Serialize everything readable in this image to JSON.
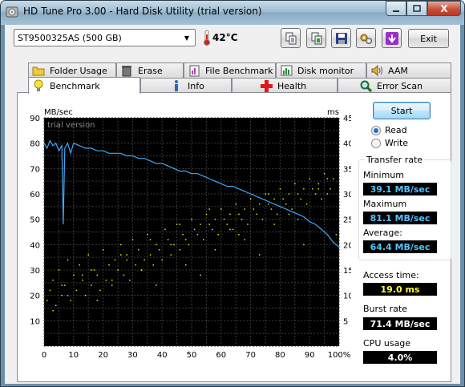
{
  "window": {
    "title": "HD Tune Pro 3.00 - Hard Disk Utility (trial version)",
    "close_glyph": "X"
  },
  "toolbar": {
    "drive": "ST9500325AS (500 GB)",
    "temperature": "42°C",
    "exit_label": "Exit",
    "buttons": [
      "copy-text-icon",
      "copy-screenshot-icon",
      "save-icon",
      "options-icon",
      "minimize-to-tray-icon"
    ]
  },
  "tabs": {
    "row1": [
      "Folder Usage",
      "Erase",
      "File Benchmark",
      "Disk monitor",
      "AAM"
    ],
    "row2": [
      "Benchmark",
      "Info",
      "Health",
      "Error Scan"
    ],
    "active": "Benchmark"
  },
  "benchmark": {
    "start_label": "Start",
    "read_label": "Read",
    "write_label": "Write",
    "mode": "Read",
    "transfer_rate_title": "Transfer rate",
    "minimum_label": "Minimum",
    "minimum_value": "39.1 MB/sec",
    "maximum_label": "Maximum",
    "maximum_value": "81.1 MB/sec",
    "average_label": "Average:",
    "average_value": "64.4 MB/sec",
    "access_time_label": "Access time:",
    "access_time_value": "19.0 ms",
    "burst_rate_label": "Burst rate",
    "burst_rate_value": "71.4 MB/sec",
    "cpu_usage_label": "CPU usage",
    "cpu_usage_value": "4.0%"
  },
  "colors": {
    "plot_bg": "#000000",
    "grid": "#3a3a3a",
    "transfer_line": "#3fa9f5",
    "access_points": "#e6e619",
    "panel_value_blue": "#4fc3ff",
    "panel_value_yellow": "#ffff3a"
  },
  "chart_data": {
    "type": "line",
    "watermark": "trial version",
    "y_left_unit": "MB/sec",
    "y_right_unit": "ms",
    "x_ticks": [
      "0",
      "10",
      "20",
      "30",
      "40",
      "50",
      "60",
      "70",
      "80",
      "90",
      "100%"
    ],
    "y_left_ticks": [
      "10",
      "20",
      "30",
      "40",
      "50",
      "60",
      "70",
      "80",
      "90"
    ],
    "y_right_ticks": [
      "5",
      "10",
      "15",
      "20",
      "25",
      "30",
      "35",
      "40",
      "45"
    ],
    "xlim": [
      0,
      100
    ],
    "ylim_left": [
      0,
      90
    ],
    "ylim_right": [
      0,
      45
    ],
    "grid": true,
    "series": [
      {
        "name": "Transfer rate",
        "axis": "left",
        "x": [
          0,
          1,
          2,
          3,
          4,
          5,
          6,
          6.5,
          7,
          8,
          9,
          10,
          12,
          14,
          16,
          18,
          20,
          22,
          24,
          26,
          28,
          30,
          32,
          34,
          36,
          38,
          40,
          42,
          44,
          46,
          48,
          50,
          52,
          54,
          56,
          58,
          60,
          62,
          64,
          66,
          68,
          70,
          72,
          74,
          76,
          78,
          80,
          82,
          84,
          86,
          88,
          90,
          92,
          94,
          96,
          98,
          100
        ],
        "values": [
          80,
          78,
          81,
          79,
          80,
          77,
          79,
          48,
          78,
          80,
          76,
          80,
          79,
          78,
          78,
          77,
          77,
          76,
          76,
          76,
          75,
          75,
          74,
          74,
          73,
          72,
          72,
          71,
          70,
          69,
          69,
          68,
          68,
          67,
          66,
          65,
          64,
          63,
          63,
          62,
          61,
          60,
          59,
          58,
          57,
          56,
          55,
          54,
          53,
          52,
          51,
          49,
          48,
          46,
          44,
          41,
          39
        ]
      }
    ],
    "scatter": {
      "name": "Access time",
      "axis": "right",
      "x": [
        1,
        2,
        3,
        4,
        5,
        6,
        7,
        8,
        9,
        10,
        11,
        12,
        13,
        14,
        15,
        16,
        17,
        18,
        19,
        20,
        21,
        22,
        23,
        24,
        25,
        26,
        27,
        28,
        29,
        30,
        31,
        32,
        33,
        34,
        35,
        36,
        37,
        38,
        39,
        40,
        41,
        42,
        43,
        44,
        45,
        46,
        47,
        48,
        49,
        50,
        51,
        52,
        53,
        54,
        55,
        56,
        57,
        58,
        59,
        60,
        61,
        62,
        63,
        64,
        65,
        66,
        67,
        68,
        69,
        70,
        71,
        72,
        73,
        74,
        75,
        76,
        77,
        78,
        79,
        80,
        81,
        82,
        83,
        84,
        85,
        86,
        87,
        88,
        89,
        90,
        91,
        92,
        93,
        94,
        95,
        96,
        97,
        98,
        99,
        3,
        8,
        13,
        18,
        23,
        28,
        33,
        38,
        43,
        48,
        53,
        58,
        63,
        68,
        73,
        78,
        83,
        88,
        93,
        6,
        16,
        26,
        36,
        46,
        56,
        66,
        76,
        86,
        96
      ],
      "values": [
        9,
        11,
        13,
        8,
        15,
        10,
        12,
        17,
        9,
        14,
        11,
        16,
        13,
        10,
        18,
        12,
        15,
        14,
        11,
        19,
        13,
        16,
        12,
        17,
        15,
        20,
        14,
        18,
        13,
        21,
        16,
        19,
        15,
        17,
        22,
        18,
        16,
        20,
        19,
        17,
        23,
        21,
        18,
        20,
        24,
        19,
        22,
        21,
        20,
        25,
        23,
        22,
        24,
        21,
        26,
        24,
        23,
        25,
        22,
        27,
        25,
        24,
        26,
        23,
        28,
        26,
        25,
        27,
        24,
        29,
        27,
        26,
        28,
        25,
        30,
        28,
        27,
        29,
        26,
        31,
        29,
        28,
        30,
        27,
        32,
        30,
        29,
        31,
        28,
        33,
        31,
        30,
        32,
        29,
        34,
        30,
        31,
        33,
        22,
        7,
        10,
        14,
        9,
        13,
        17,
        15,
        12,
        20,
        16,
        14,
        19,
        23,
        21,
        18,
        24,
        26,
        20,
        31,
        12,
        15,
        18,
        21,
        24,
        27,
        22,
        30,
        25,
        33
      ]
    }
  }
}
